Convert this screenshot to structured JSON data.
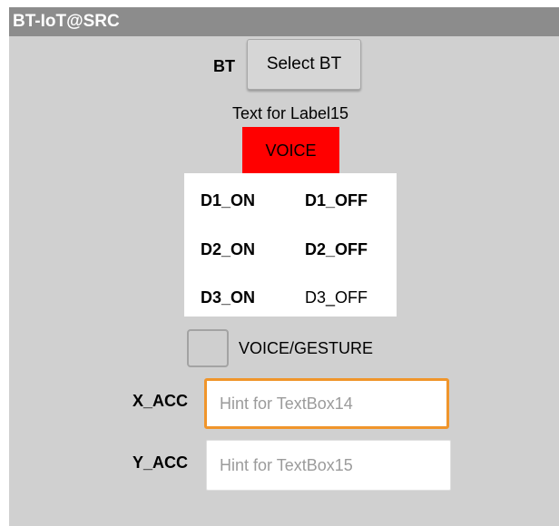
{
  "app": {
    "title": "BT-IoT@SRC"
  },
  "bluetooth": {
    "label": "BT",
    "select_button": "Select BT"
  },
  "label15": {
    "text": "Text for Label15"
  },
  "voice_button": {
    "label": "VOICE",
    "color": "#ff0000"
  },
  "devices": [
    {
      "on_label": "D1_ON",
      "off_label": "D1_OFF"
    },
    {
      "on_label": "D2_ON",
      "off_label": "D2_OFF"
    },
    {
      "on_label": "D3_ON",
      "off_label": "D3_OFF"
    }
  ],
  "mode_checkbox": {
    "label": "VOICE/GESTURE",
    "checked": false
  },
  "x_acc": {
    "label": "X_ACC",
    "value": "",
    "placeholder": "Hint for TextBox14",
    "focused": true,
    "focus_color": "#f0952b"
  },
  "y_acc": {
    "label": "Y_ACC",
    "value": "",
    "placeholder": "Hint for TextBox15",
    "focused": false
  }
}
